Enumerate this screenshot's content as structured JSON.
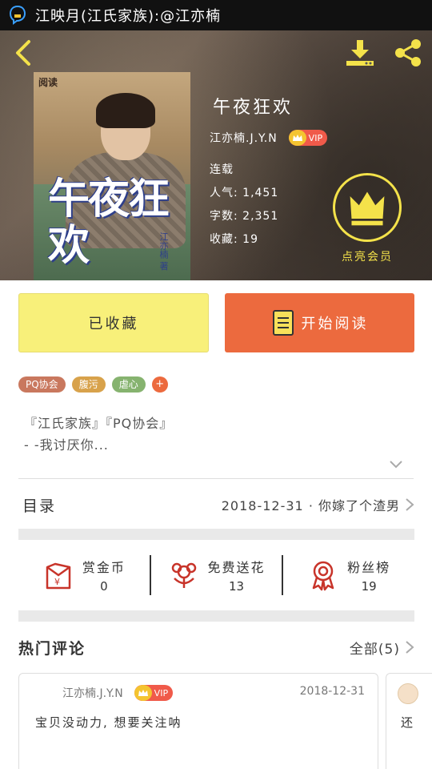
{
  "status_bar": {
    "title": "江映月(江氏家族):@江亦楠",
    "icon": "chat-bubble-icon"
  },
  "header": {
    "back_icon": "chevron-left-icon",
    "download_icon": "download-icon",
    "share_icon": "share-icon"
  },
  "book": {
    "cover_mark": "阅读",
    "cover_title_art": "午夜狂欢",
    "cover_author_art": "江亦楠 著",
    "title": "午夜狂欢",
    "author": "江亦楠.J.Y.N",
    "vip_label": "VIP",
    "status": "连载",
    "popularity": "人气: 1,451",
    "word_count": "字数: 2,351",
    "favorites": "收藏: 19"
  },
  "member": {
    "icon": "crown-icon",
    "label": "点亮会员"
  },
  "actions": {
    "favorite_label": "已收藏",
    "read_label": "开始阅读"
  },
  "tags": [
    {
      "label": "PQ协会",
      "color": "#c9785e"
    },
    {
      "label": "腹污",
      "color": "#d8a24b"
    },
    {
      "label": "虐心",
      "color": "#86b36f"
    }
  ],
  "tag_more": "+",
  "intro": {
    "line1": "『江氏家族』『PQ协会』",
    "line2": "- -我讨厌你..."
  },
  "catalog": {
    "label": "目录",
    "latest": "2018-12-31 · 你嫁了个渣男"
  },
  "stats": [
    {
      "label": "赏金币",
      "value": "0",
      "icon": "red-envelope-icon"
    },
    {
      "label": "免费送花",
      "value": "13",
      "icon": "flower-icon"
    },
    {
      "label": "粉丝榜",
      "value": "19",
      "icon": "award-ribbon-icon"
    }
  ],
  "comments": {
    "title": "热门评论",
    "all_label": "全部(5)",
    "items": [
      {
        "user": "江亦楠.J.Y.N",
        "vip": "VIP",
        "date": "2018-12-31",
        "text": "宝贝没动力, 想要关注呐"
      },
      {
        "text": "还"
      }
    ]
  },
  "colors": {
    "favorite_bg": "#f8f07a",
    "read_bg": "#ec6a3e",
    "member_gold": "#f4e24a",
    "vip_red": "#f05a4a"
  }
}
